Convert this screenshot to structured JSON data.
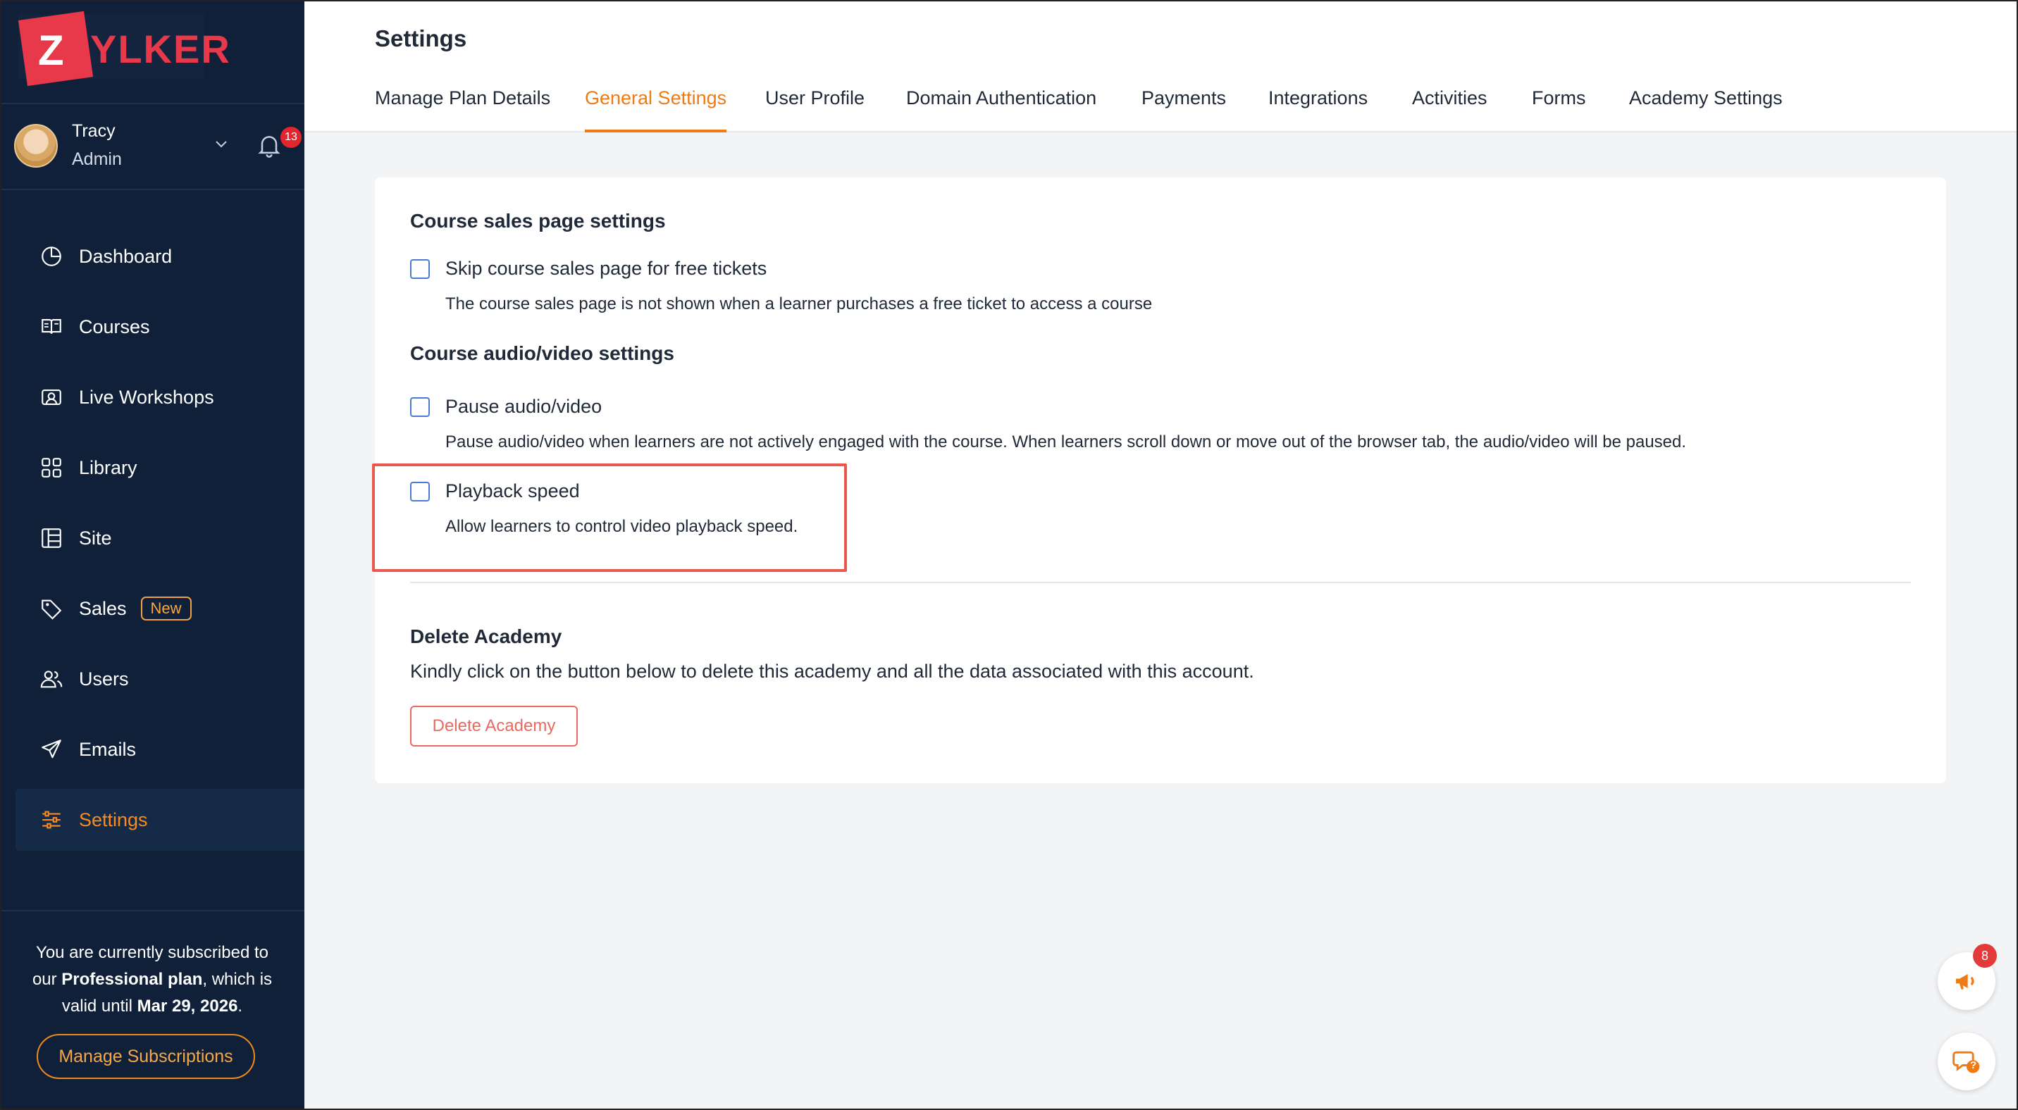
{
  "logo": {
    "first": "Z",
    "rest": "YLKER"
  },
  "user": {
    "name": "Tracy",
    "role": "Admin",
    "notifications": "13"
  },
  "sidebar": {
    "items": [
      {
        "label": "Dashboard",
        "icon": "dashboard-icon"
      },
      {
        "label": "Courses",
        "icon": "courses-icon"
      },
      {
        "label": "Live Workshops",
        "icon": "live-workshops-icon"
      },
      {
        "label": "Library",
        "icon": "library-icon"
      },
      {
        "label": "Site",
        "icon": "site-icon"
      },
      {
        "label": "Sales",
        "icon": "tag-icon",
        "badge": "New"
      },
      {
        "label": "Users",
        "icon": "users-icon"
      },
      {
        "label": "Emails",
        "icon": "send-icon"
      },
      {
        "label": "Settings",
        "icon": "sliders-icon",
        "active": true
      }
    ],
    "plan": {
      "line1": "You are currently subscribed to",
      "our": "our ",
      "plan_name": "Professional plan",
      "which_is": ", which is",
      "valid_until": "valid until ",
      "date": "Mar 29, 2026",
      "period": "."
    },
    "manage_button": "Manage Subscriptions"
  },
  "header": {
    "title": "Settings",
    "tabs": [
      "Manage Plan Details",
      "General Settings",
      "User Profile",
      "Domain Authentication",
      "Payments",
      "Integrations",
      "Activities",
      "Forms",
      "Academy Settings"
    ],
    "active_tab": "General Settings"
  },
  "settings": {
    "sales_section_title": "Course sales page settings",
    "skip_label": "Skip course sales page for free tickets",
    "skip_desc": "The course sales page is not shown when a learner purchases a free ticket to access a course",
    "av_section_title": "Course audio/video settings",
    "pause_label": "Pause audio/video",
    "pause_desc": "Pause audio/video when learners are not actively engaged with the course. When learners scroll down or move out of the browser tab, the audio/video will be paused.",
    "playback_label": "Playback speed",
    "playback_desc": "Allow learners to control video playback speed.",
    "delete_title": "Delete Academy",
    "delete_desc": "Kindly click on the button below to delete this academy and all the data associated with this account.",
    "delete_button": "Delete Academy"
  },
  "floating": {
    "announce_badge": "8",
    "help_badge": "?"
  },
  "colors": {
    "sidebar": "#0f2038",
    "accent": "#f07a14",
    "highlight": "#e8584c",
    "brand": "#e8394b"
  }
}
